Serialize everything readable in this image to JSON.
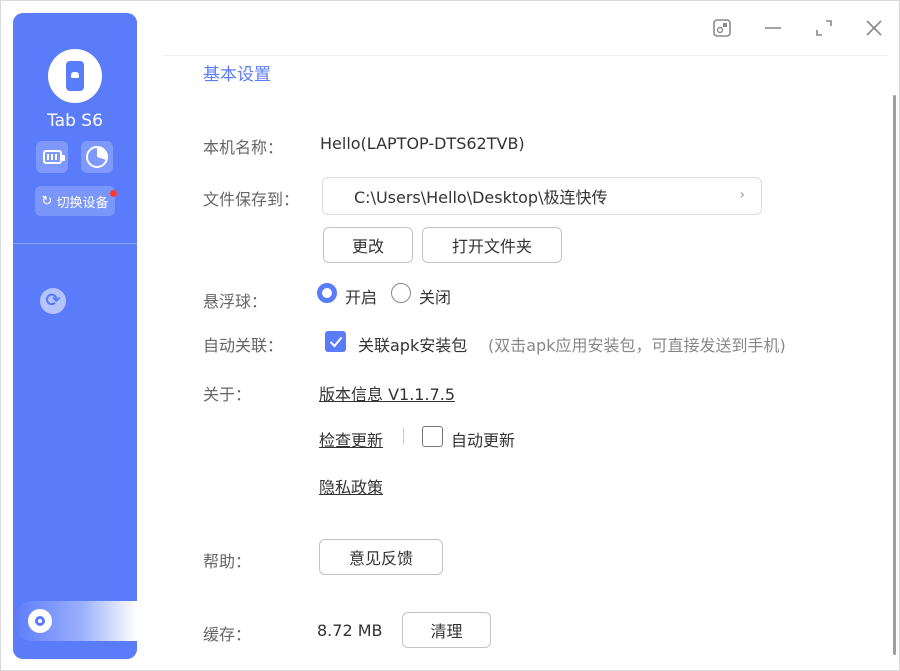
{
  "sidebar": {
    "device_name": "Tab S6",
    "switch_device_label": "切换设备",
    "accent": "#5b7cfa"
  },
  "titlebar": {
    "icons": [
      "pin-window-icon",
      "minimize-icon",
      "maximize-icon",
      "close-icon"
    ]
  },
  "settings": {
    "section_title": "基本设置",
    "device_name_label": "本机名称：",
    "device_name_value": "Hello(LAPTOP-DTS62TVB)",
    "save_to_label": "文件保存到：",
    "save_path": "C:\\Users\\Hello\\Desktop\\极连快传",
    "change_button": "更改",
    "open_folder_button": "打开文件夹",
    "float_ball_label": "悬浮球：",
    "float_on_label": "开启",
    "float_off_label": "关闭",
    "float_ball_selected": "开启",
    "auto_link_label": "自动关联：",
    "auto_link_checkbox_label": "关联apk安装包",
    "auto_link_checked": true,
    "auto_link_hint": "(双击apk应用安装包，可直接发送到手机)",
    "about_label": "关于：",
    "version_link": "版本信息 V1.1.7.5",
    "check_update_link": "检查更新",
    "auto_update_label": "自动更新",
    "auto_update_checked": false,
    "privacy_link": "隐私政策",
    "help_label": "帮助：",
    "feedback_button": "意见反馈",
    "cache_label": "缓存：",
    "cache_value": "8.72 MB",
    "clear_button": "清理"
  }
}
